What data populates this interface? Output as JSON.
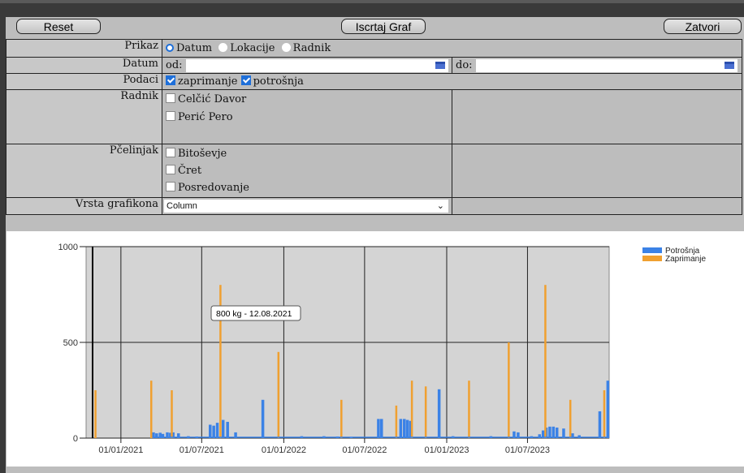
{
  "toolbar": {
    "reset_label": "Reset",
    "draw_label": "Iscrtaj Graf",
    "close_label": "Zatvori"
  },
  "form": {
    "prikaz": {
      "label": "Prikaz",
      "options": [
        "Datum",
        "Lokacije",
        "Radnik"
      ],
      "selected": "Datum"
    },
    "datum": {
      "label": "Datum",
      "from_label": "od:",
      "to_label": "do:",
      "from_value": "",
      "to_value": ""
    },
    "podaci": {
      "label": "Podaci",
      "items": [
        {
          "text": "zaprimanje",
          "checked": true
        },
        {
          "text": "potrošnja",
          "checked": true
        }
      ]
    },
    "radnik": {
      "label": "Radnik",
      "items": [
        "Celčić Davor",
        "Perić Pero"
      ]
    },
    "pcelinjak": {
      "label": "Pčelinjak",
      "items": [
        "Bitoševje",
        "Čret",
        "Posredovanje"
      ]
    },
    "vrsta": {
      "label": "Vrsta grafikona",
      "value": "Column"
    }
  },
  "chart_data": {
    "type": "bar",
    "ylim": [
      0,
      1000
    ],
    "yticks": [
      "0",
      "500",
      "1000"
    ],
    "xticks": [
      "01/01/2021",
      "01/07/2021",
      "01/01/2022",
      "01/07/2022",
      "01/01/2023",
      "01/07/2023"
    ],
    "grid": true,
    "legend_position": "top-right",
    "tooltip": "800 kg - 12.08.2021",
    "colors": {
      "Potrošnja": "#3b82e6",
      "Zaprimanje": "#f0a030",
      "plot_bg": "#d4d4d4"
    },
    "series": [
      {
        "name": "Potrošnja",
        "color": "#3b82e6",
        "points": [
          [
            "2021-03-15",
            30
          ],
          [
            "2021-03-22",
            25
          ],
          [
            "2021-03-30",
            28
          ],
          [
            "2021-04-05",
            22
          ],
          [
            "2021-04-15",
            30
          ],
          [
            "2021-04-22",
            28
          ],
          [
            "2021-04-28",
            30
          ],
          [
            "2021-05-10",
            25
          ],
          [
            "2021-06-01",
            10
          ],
          [
            "2021-06-20",
            8
          ],
          [
            "2021-07-20",
            70
          ],
          [
            "2021-07-28",
            65
          ],
          [
            "2021-08-05",
            80
          ],
          [
            "2021-08-18",
            95
          ],
          [
            "2021-08-28",
            85
          ],
          [
            "2021-09-15",
            30
          ],
          [
            "2021-11-15",
            200
          ],
          [
            "2022-02-10",
            10
          ],
          [
            "2022-04-01",
            10
          ],
          [
            "2022-05-01",
            8
          ],
          [
            "2022-06-01",
            5
          ],
          [
            "2022-08-01",
            100
          ],
          [
            "2022-08-08",
            100
          ],
          [
            "2022-09-20",
            100
          ],
          [
            "2022-09-28",
            100
          ],
          [
            "2022-10-05",
            95
          ],
          [
            "2022-10-12",
            90
          ],
          [
            "2022-12-15",
            255
          ],
          [
            "2023-01-15",
            10
          ],
          [
            "2023-04-10",
            10
          ],
          [
            "2023-06-01",
            35
          ],
          [
            "2023-06-10",
            30
          ],
          [
            "2023-07-10",
            10
          ],
          [
            "2023-07-28",
            20
          ],
          [
            "2023-08-05",
            40
          ],
          [
            "2023-08-12",
            55
          ],
          [
            "2023-08-20",
            60
          ],
          [
            "2023-08-28",
            60
          ],
          [
            "2023-09-05",
            55
          ],
          [
            "2023-09-20",
            50
          ],
          [
            "2023-10-10",
            25
          ],
          [
            "2023-10-25",
            15
          ],
          [
            "2023-12-10",
            140
          ],
          [
            "2023-12-28",
            300
          ]
        ]
      },
      {
        "name": "Zaprimanje",
        "color": "#f0a030",
        "points": [
          [
            "2020-11-05",
            250
          ],
          [
            "2021-03-10",
            300
          ],
          [
            "2021-04-25",
            250
          ],
          [
            "2021-08-12",
            800
          ],
          [
            "2021-12-20",
            450
          ],
          [
            "2022-05-10",
            200
          ],
          [
            "2022-09-10",
            170
          ],
          [
            "2022-10-15",
            300
          ],
          [
            "2022-11-15",
            270
          ],
          [
            "2023-02-20",
            300
          ],
          [
            "2023-05-20",
            500
          ],
          [
            "2023-08-10",
            800
          ],
          [
            "2023-10-05",
            200
          ],
          [
            "2023-12-20",
            250
          ]
        ]
      }
    ]
  }
}
